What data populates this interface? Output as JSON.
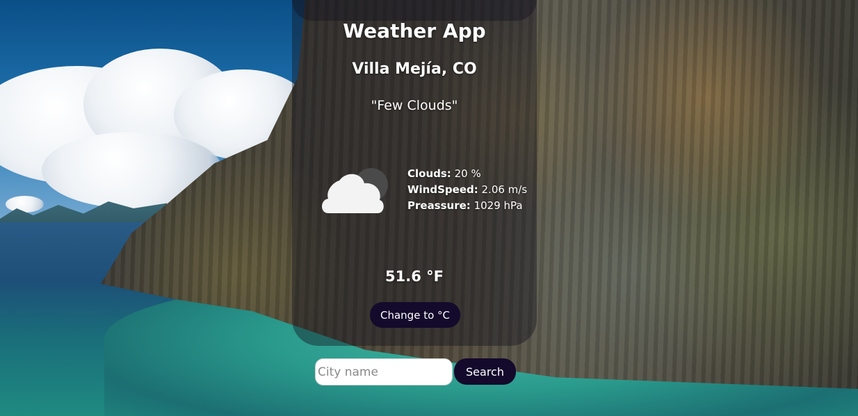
{
  "app": {
    "title": "Weather App"
  },
  "location": {
    "city": "Villa Mejía, CO"
  },
  "weather": {
    "description": "\"Few Clouds\"",
    "icon": "few-clouds-night-icon",
    "details": [
      {
        "label": "Clouds:",
        "value": "20 %"
      },
      {
        "label": "WindSpeed:",
        "value": "2.06 m/s"
      },
      {
        "label": "Preassure:",
        "value": "1029 hPa"
      }
    ],
    "temperature": "51.6 °F"
  },
  "controls": {
    "unit_toggle_label": "Change to °C",
    "search_placeholder": "City name",
    "search_value": "",
    "search_button_label": "Search"
  },
  "colors": {
    "button_bg": "#140a2c",
    "card_bg": "rgba(20,20,30,0.42)",
    "text": "#ffffff"
  }
}
